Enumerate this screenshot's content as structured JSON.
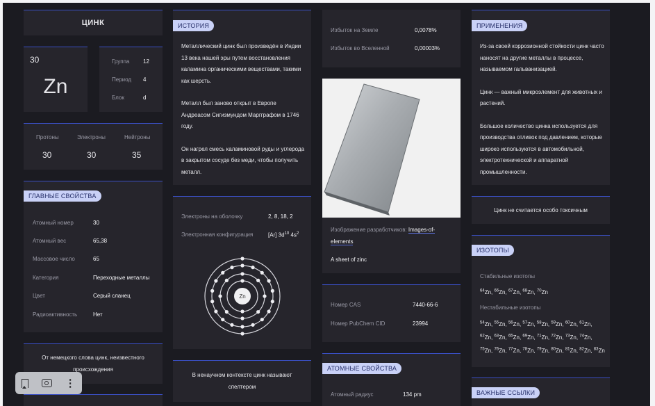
{
  "element": {
    "name": "ЦИНК",
    "number": "30",
    "symbol": "Zn",
    "group_label": "Группа",
    "group": "12",
    "period_label": "Период",
    "period": "4",
    "block_label": "Блок",
    "block": "d"
  },
  "particles": {
    "protons_label": "Протоны",
    "protons": "30",
    "electrons_label": "Электроны",
    "electrons": "30",
    "neutrons_label": "Нейтроны",
    "neutrons": "35"
  },
  "main_props": {
    "title": "ГЛАВНЫЕ СВОЙСТВА",
    "rows": [
      {
        "label": "Атомный номер",
        "value": "30"
      },
      {
        "label": "Атомный вес",
        "value": "65,38"
      },
      {
        "label": "Массовое число",
        "value": "65"
      },
      {
        "label": "Категория",
        "value": "Переходные металлы"
      },
      {
        "label": "Цвет",
        "value": "Серый сланец"
      },
      {
        "label": "Радиоактивность",
        "value": "Нет"
      }
    ]
  },
  "etymology": "От немецкого слова цинк, неизвестного происхождения",
  "history": {
    "title": "ИСТОРИЯ",
    "p1": "Металлический цинк был произведён в Индии 13 века нашей эры путем восстановления каламина органическими веществами, такими как шерсть.",
    "p2": "Металл был заново открыт в Европе Андреасом Сигизмундом Маргграфом в 1746 году.",
    "p3": "Он нагрел смесь каламиновой руды и углерода в закрытом сосуде без меди, чтобы получить металл."
  },
  "electrons": {
    "shells_label": "Электроны на оболочку",
    "shells": "2, 8, 18, 2",
    "config_label": "Электронная конфигурация",
    "config_base": "[Ar] 3d",
    "config_exp1": "10",
    "config_mid": " 4s",
    "config_exp2": "2",
    "nucleus": "Zn"
  },
  "spelter": "В ненаучном контексте цинк называют спелтером",
  "abundance": {
    "earth_label": "Избыток на Земле",
    "earth": "0,0078%",
    "universe_label": "Избыток во Вселенной",
    "universe": "0,00003%"
  },
  "image": {
    "credit_label": "Изображение разработчиков:",
    "credit_link": "Images-of-elements",
    "caption": "A sheet of zinc"
  },
  "ids": {
    "cas_label": "Номер CAS",
    "cas": "7440-66-6",
    "pubchem_label": "Номер PubChem CID",
    "pubchem": "23994"
  },
  "atomic": {
    "title": "АТОМНЫЕ СВОЙСТВА",
    "radius_label": "Атомный радиус",
    "radius": "134 pm"
  },
  "uses": {
    "title": "ПРИМЕНЕНИЯ",
    "p1": "Из-за своей коррозионной стойкости цинк часто наносят на другие металлы в процессе, называемом гальванизацией.",
    "p2": "Цинк — важный микроэлемент для животных и растений.",
    "p3": "Большое количество цинка используется для производства отливок под давлением, которые широко используются в автомобильной, электротехнической и аппаратной промышленности."
  },
  "toxicity": "Цинк не считается особо токсичным",
  "isotopes": {
    "title": "ИЗОТОПЫ",
    "stable_label": "Стабильные изотопы",
    "stable": [
      "64",
      "66",
      "67",
      "68",
      "70"
    ],
    "unstable_label": "Нестабильные изотопы",
    "unstable": [
      "54",
      "55",
      "56",
      "57",
      "58",
      "59",
      "60",
      "61",
      "62",
      "63",
      "65",
      "69",
      "71",
      "72",
      "73",
      "74",
      "75",
      "76",
      "77",
      "78",
      "79",
      "80",
      "81",
      "82",
      "83"
    ]
  },
  "links": {
    "title": "ВАЖНЫЕ ССЫЛКИ"
  },
  "icons": [
    "bookmark-icon",
    "lens-icon",
    "more-vertical-icon"
  ]
}
